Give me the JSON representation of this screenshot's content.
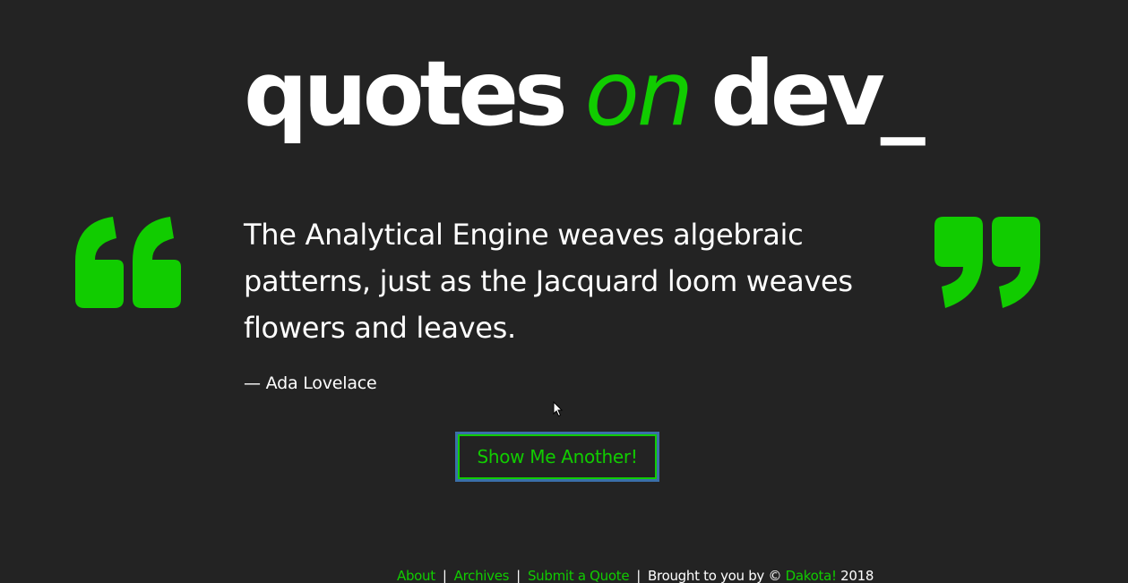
{
  "header": {
    "title_part1": "quotes",
    "title_part2": "on",
    "title_part3": "dev_"
  },
  "quote": {
    "text": "The Analytical Engine weaves algebraic patterns, just as the Jacquard loom weaves flowers and leaves.",
    "author": "— Ada Lovelace",
    "open_icon": "open-quote-icon",
    "close_icon": "close-quote-icon"
  },
  "actions": {
    "show_another_label": "Show Me Another!"
  },
  "footer": {
    "about_label": "About",
    "archives_label": "Archives",
    "submit_label": "Submit a Quote",
    "separator": "|",
    "credit_text": "Brought to you by ©",
    "author_link_label": "Dakota!",
    "year": "2018"
  },
  "colors": {
    "background": "#232323",
    "accent": "#11cc00",
    "text": "#ffffff",
    "focus_ring": "#3a6fa8"
  }
}
